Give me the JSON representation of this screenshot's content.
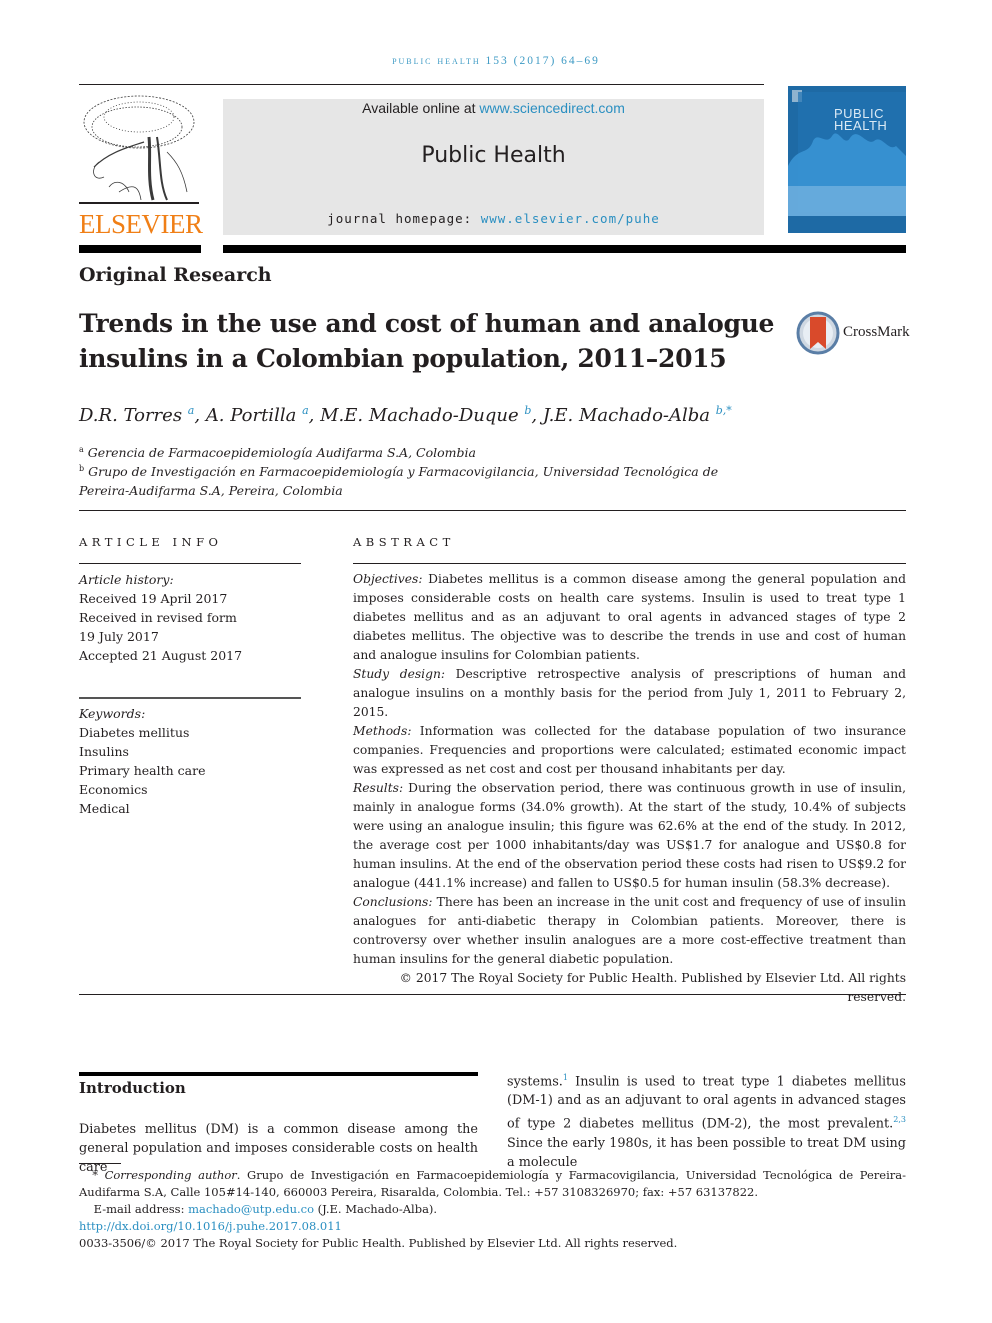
{
  "running_header": "Public Health 153 (2017) 64–69",
  "masthead": {
    "available_prefix": "Available online at ",
    "available_link": "www.sciencedirect.com",
    "journal_name": "Public Health",
    "homepage_prefix": "journal homepage: ",
    "homepage_link": "www.elsevier.com/puhe"
  },
  "publisher_logo": {
    "icon": "elsevier-tree-icon",
    "wordmark": "ELSEVIER",
    "color": "#f07f16"
  },
  "cover": {
    "title_line1": "PUBLIC",
    "title_line2": "HEALTH",
    "color": "#1e6aa5"
  },
  "article_type": "Original Research",
  "title": "Trends in the use and cost of human and analogue insulins in a Colombian population, 2011–2015",
  "crossmark": {
    "icon": "crossmark-icon",
    "label": "CrossMark"
  },
  "authors": [
    {
      "name": "D.R. Torres",
      "sup": "a"
    },
    {
      "name": "A. Portilla",
      "sup": "a"
    },
    {
      "name": "M.E. Machado-Duque",
      "sup": "b"
    },
    {
      "name": "J.E. Machado-Alba",
      "sup": "b,*"
    }
  ],
  "affiliations": [
    {
      "sup": "a",
      "text": "Gerencia de Farmacoepidemiología Audifarma S.A, Colombia"
    },
    {
      "sup": "b",
      "text_line1": "Grupo de Investigación en Farmacoepidemiología y Farmacovigilancia, Universidad Tecnológica de",
      "text_line2": "Pereira-Audifarma S.A, Pereira, Colombia"
    }
  ],
  "article_info": {
    "heading": "ARTICLE INFO",
    "history_label": "Article history:",
    "history": [
      "Received 19 April 2017",
      "Received in revised form",
      "19 July 2017",
      "Accepted 21 August 2017"
    ],
    "keywords_label": "Keywords:",
    "keywords": [
      "Diabetes mellitus",
      "Insulins",
      "Primary health care",
      "Economics",
      "Medical"
    ]
  },
  "abstract": {
    "heading": "ABSTRACT",
    "sections": [
      {
        "label": "Objectives:",
        "text": "Diabetes mellitus is a common disease among the general population and imposes considerable costs on health care systems. Insulin is used to treat type 1 diabetes mellitus and as an adjuvant to oral agents in advanced stages of type 2 diabetes mellitus. The objective was to describe the trends in use and cost of human and analogue insulins for Colombian patients."
      },
      {
        "label": "Study design:",
        "text": "Descriptive retrospective analysis of prescriptions of human and analogue insulins on a monthly basis for the period from July 1, 2011 to February 2, 2015."
      },
      {
        "label": "Methods:",
        "text": "Information was collected for the database population of two insurance companies. Frequencies and proportions were calculated; estimated economic impact was expressed as net cost and cost per thousand inhabitants per day."
      },
      {
        "label": "Results:",
        "text": "During the observation period, there was continuous growth in use of insulin, mainly in analogue forms (34.0% growth). At the start of the study, 10.4% of subjects were using an analogue insulin; this figure was 62.6% at the end of the study. In 2012, the average cost per 1000 inhabitants/day was US$1.7 for analogue and US$0.8 for human insulins. At the end of the observation period these costs had risen to US$9.2 for analogue (441.1% increase) and fallen to US$0.5 for human insulin (58.3% decrease)."
      },
      {
        "label": "Conclusions:",
        "text": "There has been an increase in the unit cost and frequency of use of insulin analogues for anti-diabetic therapy in Colombian patients. Moreover, there is controversy over whether insulin analogues are a more cost-effective treatment than human insulins for the general diabetic population."
      }
    ],
    "copyright": "© 2017 The Royal Society for Public Health. Published by Elsevier Ltd. All rights reserved."
  },
  "introduction": {
    "heading": "Introduction",
    "left_text": "Diabetes mellitus (DM) is a common disease among the general population and imposes considerable costs on health care",
    "right_part1": "systems.",
    "right_ref1": "1",
    "right_part2": " Insulin is used to treat type 1 diabetes mellitus (DM-1) and as an adjuvant to oral agents in advanced stages of type 2 diabetes mellitus (DM-2), the most prevalent.",
    "right_ref2": "2,3",
    "right_part3": " Since the early 1980s, it has been possible to treat DM using a molecule"
  },
  "footnotes": {
    "corresponding_marker": "*",
    "corresponding_label": "Corresponding author",
    "corresponding_text": ". Grupo de Investigación en Farmacoepidemiología y Farmacovigilancia, Universidad Tecnológica de Pereira-Audifarma S.A, Calle 105#14-140, 660003 Pereira, Risaralda, Colombia. Tel.: +57 3108326970; fax: +57 63137822.",
    "email_label": "E-mail address: ",
    "email": "machado@utp.edu.co",
    "email_owner": " (J.E. Machado-Alba).",
    "doi": "http://dx.doi.org/10.1016/j.puhe.2017.08.011",
    "issn_line": "0033-3506/© 2017 The Royal Society for Public Health. Published by Elsevier Ltd. All rights reserved."
  }
}
